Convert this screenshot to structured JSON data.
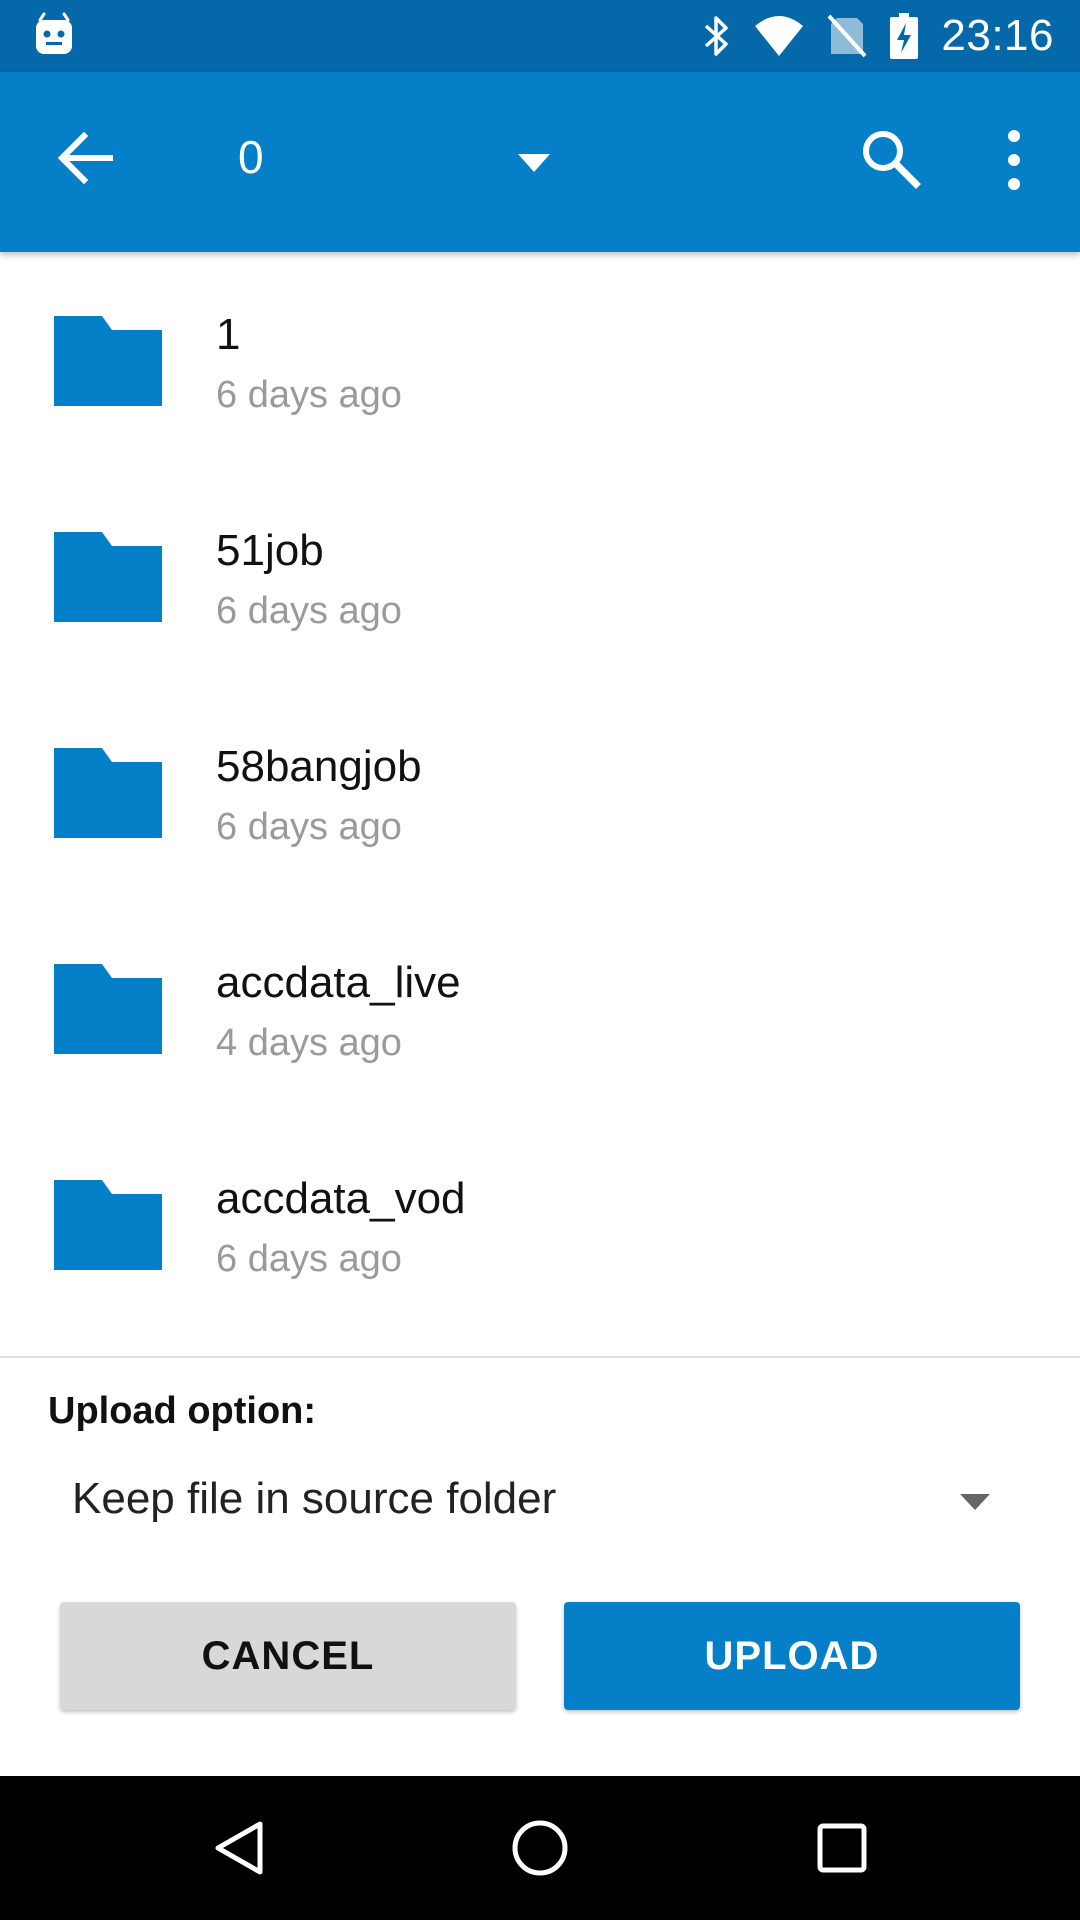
{
  "status_bar": {
    "time": "23:16",
    "icons": [
      "android-debug-icon",
      "bluetooth-icon",
      "wifi-icon",
      "no-sim-icon",
      "battery-charging-icon"
    ]
  },
  "app_bar": {
    "title": "0",
    "icons": [
      "back-arrow-icon",
      "dropdown-caret-icon",
      "search-icon",
      "more-vert-icon"
    ]
  },
  "folders": [
    {
      "name": "1",
      "modified": "6 days ago"
    },
    {
      "name": "51job",
      "modified": "6 days ago"
    },
    {
      "name": "58bangjob",
      "modified": "6 days ago"
    },
    {
      "name": "accdata_live",
      "modified": "4 days ago"
    },
    {
      "name": "accdata_vod",
      "modified": "6 days ago"
    }
  ],
  "upload": {
    "label": "Upload option:",
    "selected_option": "Keep file in source folder"
  },
  "buttons": {
    "cancel": "CANCEL",
    "upload": "UPLOAD"
  },
  "colors": {
    "status_bar": "#0568a8",
    "app_bar": "#0580c8",
    "folder_icon": "#0580c8",
    "secondary_text": "#9a9a9a",
    "cancel_button": "#d8d8d8",
    "upload_button": "#0580c8"
  },
  "nav_bar": {
    "icons": [
      "nav-back-icon",
      "nav-home-icon",
      "nav-recents-icon"
    ]
  }
}
